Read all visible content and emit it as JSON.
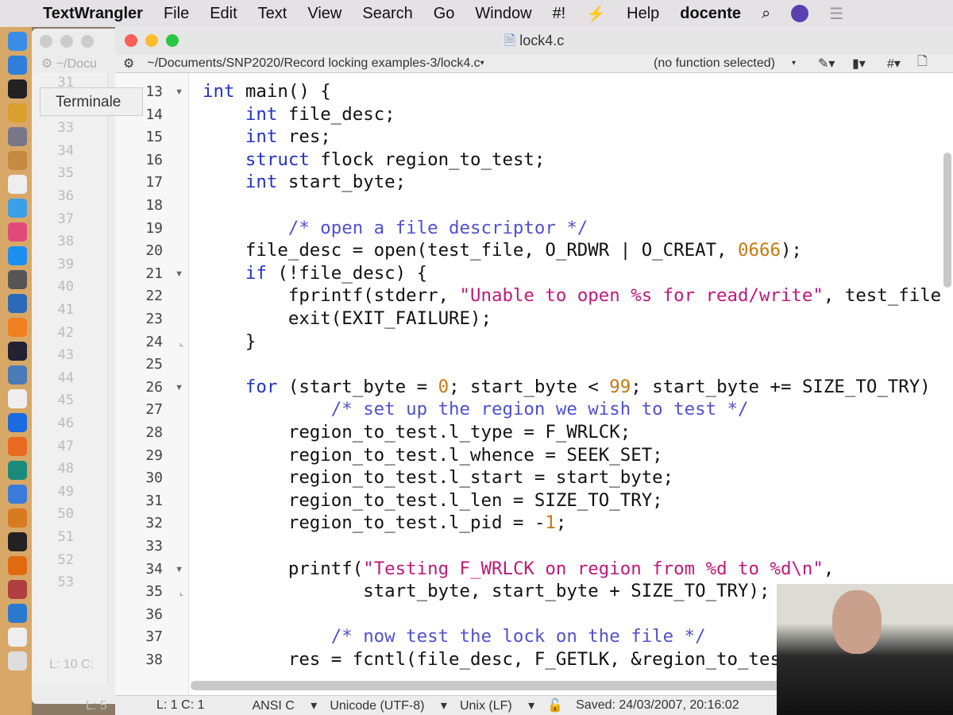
{
  "menubar": {
    "app": "TextWrangler",
    "items": [
      "File",
      "Edit",
      "Text",
      "View",
      "Search",
      "Go",
      "Window",
      "#!",
      "Help"
    ],
    "user": "docente"
  },
  "tooltip": "Terminale",
  "bg_window": {
    "path": "~/Docu",
    "status": "L: 10 C:",
    "status2": "L: 5",
    "line_numbers": [
      31,
      32,
      33,
      34,
      35,
      36,
      37,
      38,
      39,
      40,
      41,
      42,
      43,
      44,
      45,
      46,
      47,
      48,
      49,
      50,
      51,
      52,
      53
    ]
  },
  "window": {
    "title": "lock4.c",
    "path": "~/Documents/SNP2020/Record locking examples-3/lock4.c",
    "function_menu": "(no function selected)"
  },
  "status": {
    "position": "L: 1 C: 1",
    "language": "ANSI C",
    "encoding": "Unicode (UTF-8)",
    "line_endings": "Unix (LF)",
    "saved": "Saved: 24/03/2007, 20:16:02"
  },
  "code": {
    "first_line": 13,
    "fold_open": [
      13,
      21,
      26,
      34
    ],
    "fold_end": [
      24,
      35
    ],
    "lines": [
      [
        [
          "kw",
          "int"
        ],
        [
          "t",
          " main() {"
        ]
      ],
      [
        [
          "t",
          "    "
        ],
        [
          "kw",
          "int"
        ],
        [
          "t",
          " file_desc;"
        ]
      ],
      [
        [
          "t",
          "    "
        ],
        [
          "kw",
          "int"
        ],
        [
          "t",
          " res;"
        ]
      ],
      [
        [
          "t",
          "    "
        ],
        [
          "kw",
          "struct"
        ],
        [
          "t",
          " flock region_to_test;"
        ]
      ],
      [
        [
          "t",
          "    "
        ],
        [
          "kw",
          "int"
        ],
        [
          "t",
          " start_byte;"
        ]
      ],
      [],
      [
        [
          "t",
          "        "
        ],
        [
          "cm",
          "/* open a file descriptor */"
        ]
      ],
      [
        [
          "t",
          "    file_desc = open(test_file, O_RDWR | O_CREAT, "
        ],
        [
          "nm",
          "0666"
        ],
        [
          "t",
          ");"
        ]
      ],
      [
        [
          "t",
          "    "
        ],
        [
          "kw",
          "if"
        ],
        [
          "t",
          " (!file_desc) {"
        ]
      ],
      [
        [
          "t",
          "        fprintf(stderr, "
        ],
        [
          "st",
          "\"Unable to open %s for read/write\""
        ],
        [
          "t",
          ", test_file"
        ]
      ],
      [
        [
          "t",
          "        exit(EXIT_FAILURE);"
        ]
      ],
      [
        [
          "t",
          "    }"
        ]
      ],
      [],
      [
        [
          "t",
          "    "
        ],
        [
          "kw",
          "for"
        ],
        [
          "t",
          " (start_byte = "
        ],
        [
          "nm",
          "0"
        ],
        [
          "t",
          "; start_byte < "
        ],
        [
          "nm",
          "99"
        ],
        [
          "t",
          "; start_byte += SIZE_TO_TRY)"
        ]
      ],
      [
        [
          "t",
          "            "
        ],
        [
          "cm",
          "/* set up the region we wish to test */"
        ]
      ],
      [
        [
          "t",
          "        region_to_test.l_type = F_WRLCK;"
        ]
      ],
      [
        [
          "t",
          "        region_to_test.l_whence = SEEK_SET;"
        ]
      ],
      [
        [
          "t",
          "        region_to_test.l_start = start_byte;"
        ]
      ],
      [
        [
          "t",
          "        region_to_test.l_len = SIZE_TO_TRY;"
        ]
      ],
      [
        [
          "t",
          "        region_to_test.l_pid = -"
        ],
        [
          "nm",
          "1"
        ],
        [
          "t",
          ";"
        ]
      ],
      [],
      [
        [
          "t",
          "        printf("
        ],
        [
          "st",
          "\"Testing F_WRLCK on region from %d to %d\\n\""
        ],
        [
          "t",
          ","
        ]
      ],
      [
        [
          "t",
          "               start_byte, start_byte + SIZE_TO_TRY);"
        ]
      ],
      [],
      [
        [
          "t",
          "            "
        ],
        [
          "cm",
          "/* now test the lock on the file */"
        ]
      ],
      [
        [
          "t",
          "        res = fcntl(file_desc, F_GETLK, &region_to_test"
        ]
      ]
    ]
  }
}
